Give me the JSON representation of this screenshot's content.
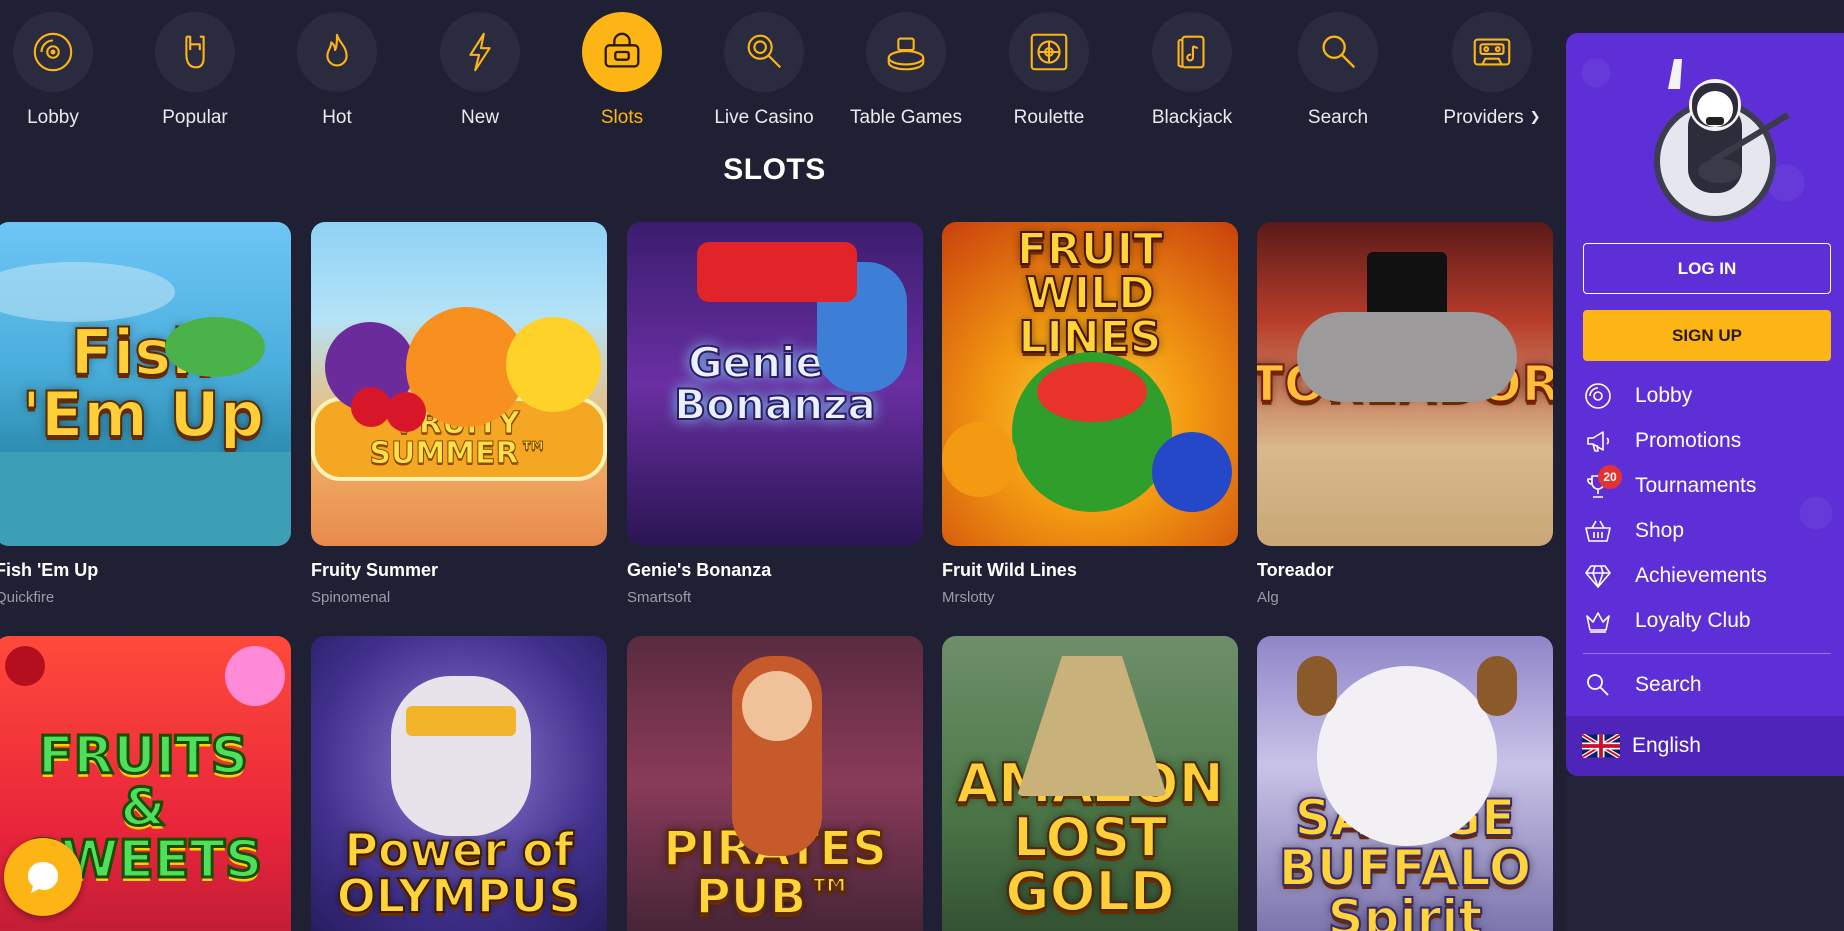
{
  "nav": {
    "items": [
      {
        "label": "Lobby",
        "icon": "disc-icon"
      },
      {
        "label": "Popular",
        "icon": "rock-hand-icon"
      },
      {
        "label": "Hot",
        "icon": "flame-icon"
      },
      {
        "label": "New",
        "icon": "lightning-icon"
      },
      {
        "label": "Slots",
        "icon": "slot-bag-icon",
        "active": true
      },
      {
        "label": "Live Casino",
        "icon": "magnifier-live-icon"
      },
      {
        "label": "Table Games",
        "icon": "poker-table-icon"
      },
      {
        "label": "Roulette",
        "icon": "roulette-icon"
      },
      {
        "label": "Blackjack",
        "icon": "cards-icon"
      },
      {
        "label": "Search",
        "icon": "search-icon"
      },
      {
        "label": "Providers",
        "icon": "cassette-icon"
      }
    ],
    "active_color": "#fdb515"
  },
  "section": {
    "title": "SLOTS"
  },
  "games": [
    {
      "name": "Fish 'Em Up",
      "provider": "Quickfire",
      "art_text": "Fish 'Em Up"
    },
    {
      "name": "Fruity Summer",
      "provider": "Spinomenal",
      "art_text": "FRUITY SUMMER™"
    },
    {
      "name": "Genie's Bonanza",
      "provider": "Smartsoft",
      "art_text": "Genie's Bonanza"
    },
    {
      "name": "Fruit Wild Lines",
      "provider": "Mrslotty",
      "art_text": "FRUIT WILD LINES"
    },
    {
      "name": "Toreador",
      "provider": "Alg",
      "art_text": "TOREADOR"
    },
    {
      "name": "",
      "provider": "",
      "art_text": "FRUITS & SWEETS"
    },
    {
      "name": "",
      "provider": "",
      "art_text": "Power of OLYMPUS"
    },
    {
      "name": "",
      "provider": "",
      "art_text": "PIRATES PUB™"
    },
    {
      "name": "",
      "provider": "",
      "art_text": "AMAZON LOST GOLD"
    },
    {
      "name": "",
      "provider": "",
      "art_text": "SAVAGE BUFFALO Spirit"
    }
  ],
  "sidebar": {
    "login_label": "LOG IN",
    "signup_label": "SIGN UP",
    "menu": [
      {
        "label": "Lobby",
        "icon": "disc-icon"
      },
      {
        "label": "Promotions",
        "icon": "megaphone-icon"
      },
      {
        "label": "Tournaments",
        "icon": "trophy-icon",
        "badge": "20"
      },
      {
        "label": "Shop",
        "icon": "basket-icon"
      },
      {
        "label": "Achievements",
        "icon": "diamond-icon"
      },
      {
        "label": "Loyalty Club",
        "icon": "crown-icon"
      }
    ],
    "search_label": "Search",
    "language": "English",
    "bg_color": "#5e2fd6"
  },
  "colors": {
    "page_bg": "#1f2033",
    "accent": "#fdb515"
  }
}
